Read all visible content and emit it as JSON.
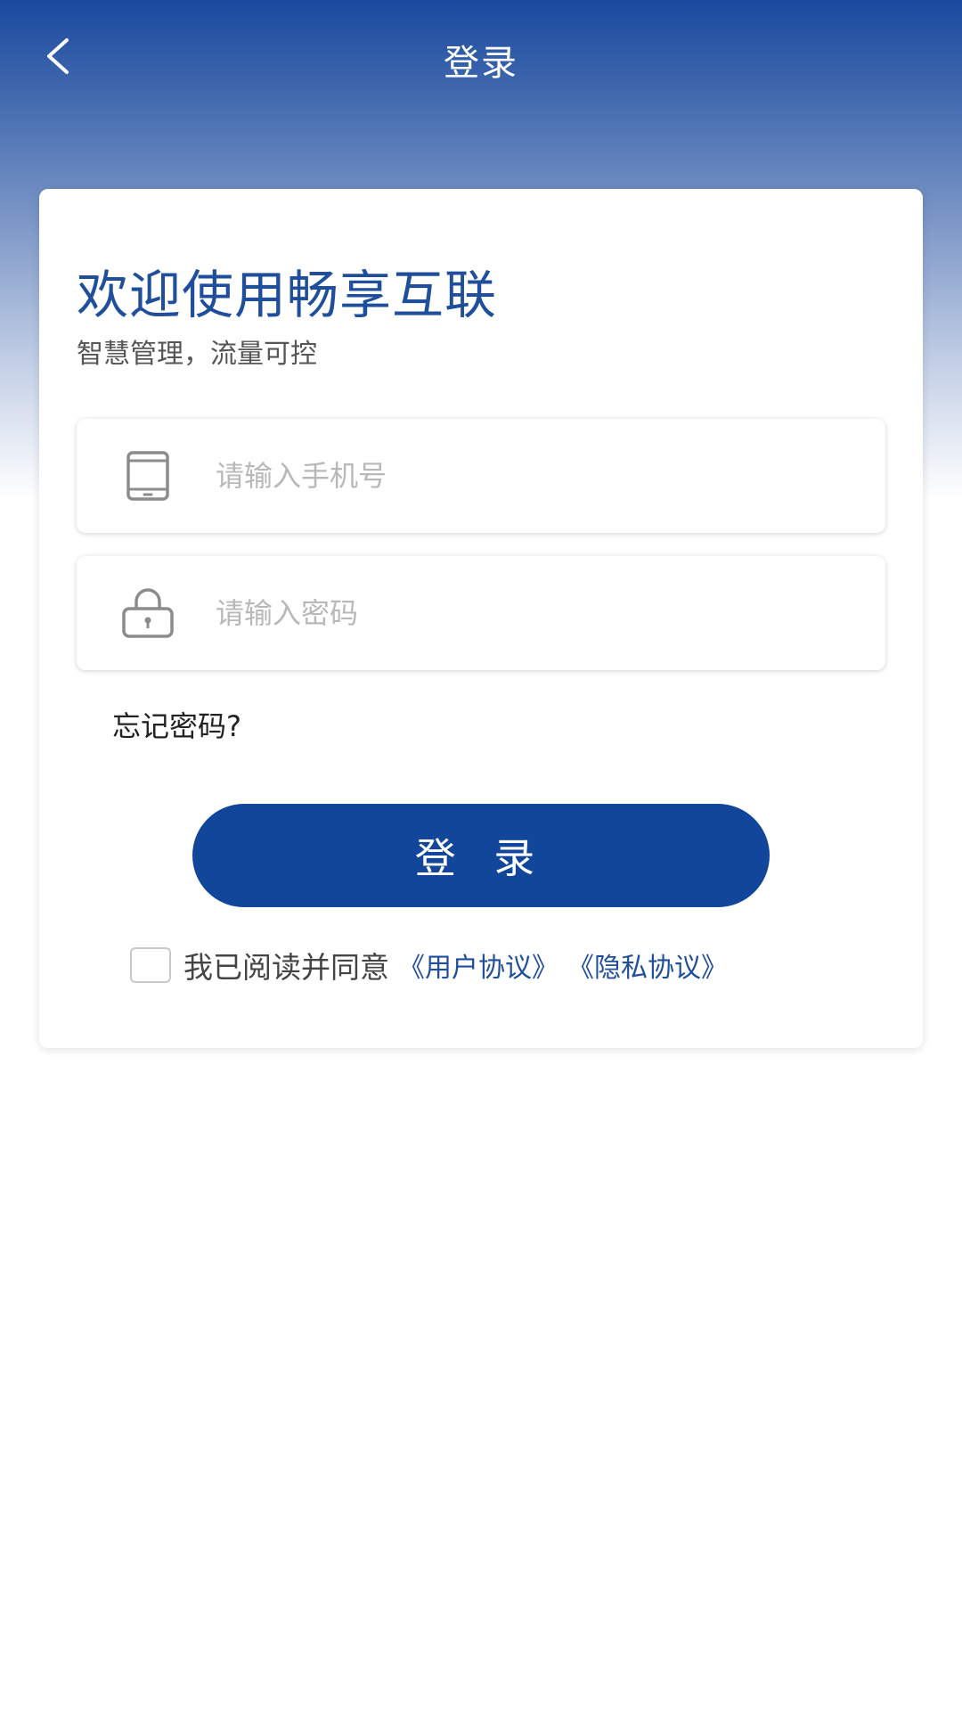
{
  "header": {
    "title": "登录",
    "back_icon": "chevron-left-icon"
  },
  "colors": {
    "primary": "#12469b",
    "heading": "#1f4e9c",
    "gradient_top": "#1a4a9f"
  },
  "card": {
    "welcome_title": "欢迎使用畅享互联",
    "subtitle": "智慧管理，流量可控",
    "phone_field": {
      "icon": "mobile-phone-icon",
      "placeholder": "请输入手机号",
      "value": ""
    },
    "password_field": {
      "icon": "lock-icon",
      "placeholder": "请输入密码",
      "value": ""
    },
    "forgot_password": "忘记密码?",
    "login_button": "登 录",
    "agreement": {
      "checked": false,
      "text": "我已阅读并同意",
      "user_agreement": "《用户协议》",
      "privacy_agreement": "《隐私协议》"
    }
  }
}
